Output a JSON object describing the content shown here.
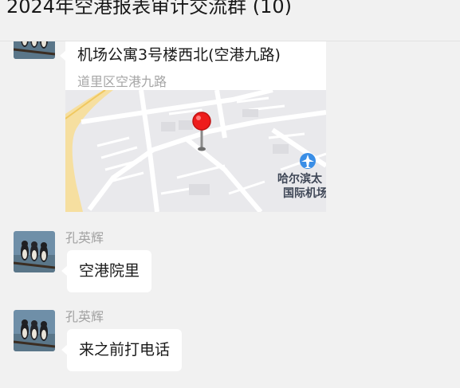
{
  "header": {
    "title": "2024年空港报表审计交流群 (10)"
  },
  "messages": [
    {
      "type": "location",
      "location_name": "机场公寓3号楼西北(空港九路)",
      "location_address": "道里区空港九路",
      "map_label_line1": "哈尔滨太",
      "map_label_line2": "国际机场"
    },
    {
      "type": "text",
      "sender": "孔英辉",
      "text": "空港院里"
    },
    {
      "type": "text",
      "sender": "孔英辉",
      "text": "来之前打电话"
    }
  ],
  "colors": {
    "background": "#f1f1f1",
    "bubble": "#ffffff",
    "pin": "#ee1c1c",
    "airport_icon": "#3a8ee6"
  }
}
